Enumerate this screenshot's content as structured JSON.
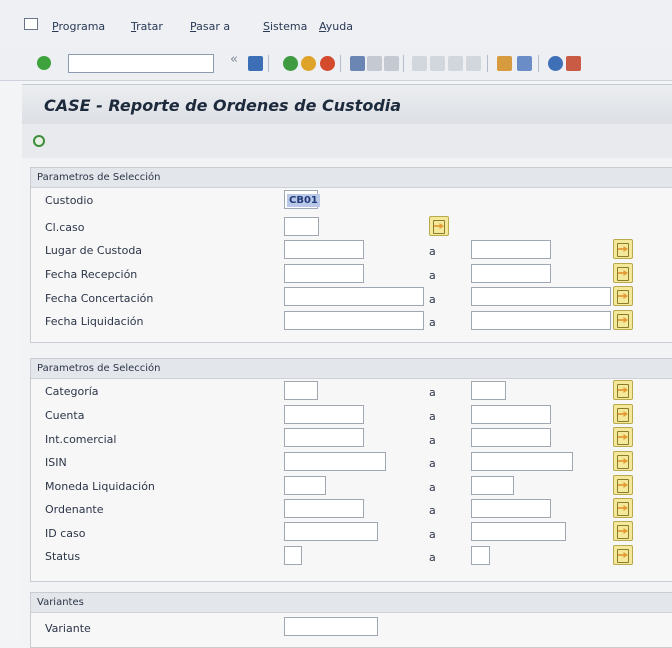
{
  "menu": [
    "Programa",
    "Tratar",
    "Pasar a",
    "Sistema",
    "Ayuda"
  ],
  "toolbar": {
    "command_value": ""
  },
  "page": {
    "title": "CASE - Reporte de Ordenes de Custodia"
  },
  "colors": {
    "accent": "#f4e99a",
    "header": "#e3e6ea",
    "selection": "#b8c8e6"
  },
  "group1": {
    "header": "Parametros de Selección",
    "rows": [
      {
        "label": "Custodio",
        "value": "CB01"
      },
      {
        "label": "Cl.caso"
      },
      {
        "label": "Lugar de Custoda",
        "sep": "a"
      },
      {
        "label": "Fecha Recepción",
        "sep": "a"
      },
      {
        "label": "Fecha Concertación",
        "sep": "a"
      },
      {
        "label": "Fecha Liquidación",
        "sep": "a"
      }
    ]
  },
  "group2": {
    "header": "Parametros de Selección",
    "rows": [
      {
        "label": "Categoría",
        "sep": "a"
      },
      {
        "label": "Cuenta",
        "sep": "a"
      },
      {
        "label": "Int.comercial",
        "sep": "a"
      },
      {
        "label": "ISIN",
        "sep": "a"
      },
      {
        "label": "Moneda Liquidación",
        "sep": "a"
      },
      {
        "label": "Ordenante",
        "sep": "a"
      },
      {
        "label": "ID caso",
        "sep": "a"
      },
      {
        "label": "Status",
        "sep": "a"
      }
    ]
  },
  "group3": {
    "header": "Variantes",
    "rows": [
      {
        "label": "Variante"
      }
    ]
  }
}
